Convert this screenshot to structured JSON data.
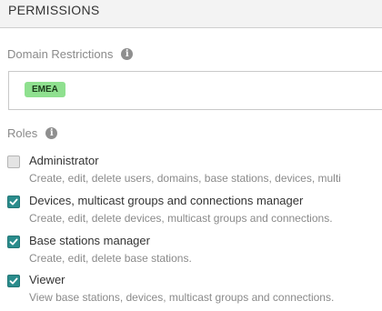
{
  "header": {
    "title": "PERMISSIONS"
  },
  "domain_restrictions": {
    "label": "Domain Restrictions",
    "info_icon": "info-icon",
    "tags": [
      "EMEA"
    ]
  },
  "roles": {
    "label": "Roles",
    "info_icon": "info-icon",
    "items": [
      {
        "name": "Administrator",
        "description": "Create, edit, delete users, domains, base stations, devices, multi",
        "checked": false
      },
      {
        "name": "Devices, multicast groups and connections manager",
        "description": "Create, edit, delete devices, multicast groups and connections.",
        "checked": true
      },
      {
        "name": "Base stations manager",
        "description": "Create, edit, delete base stations.",
        "checked": true
      },
      {
        "name": "Viewer",
        "description": "View base stations, devices, multicast groups and connections.",
        "checked": true
      }
    ]
  },
  "colors": {
    "checkbox_checked": "#2a8c8c",
    "tag_background": "#8fe08f",
    "header_background": "#f3f3f3"
  }
}
